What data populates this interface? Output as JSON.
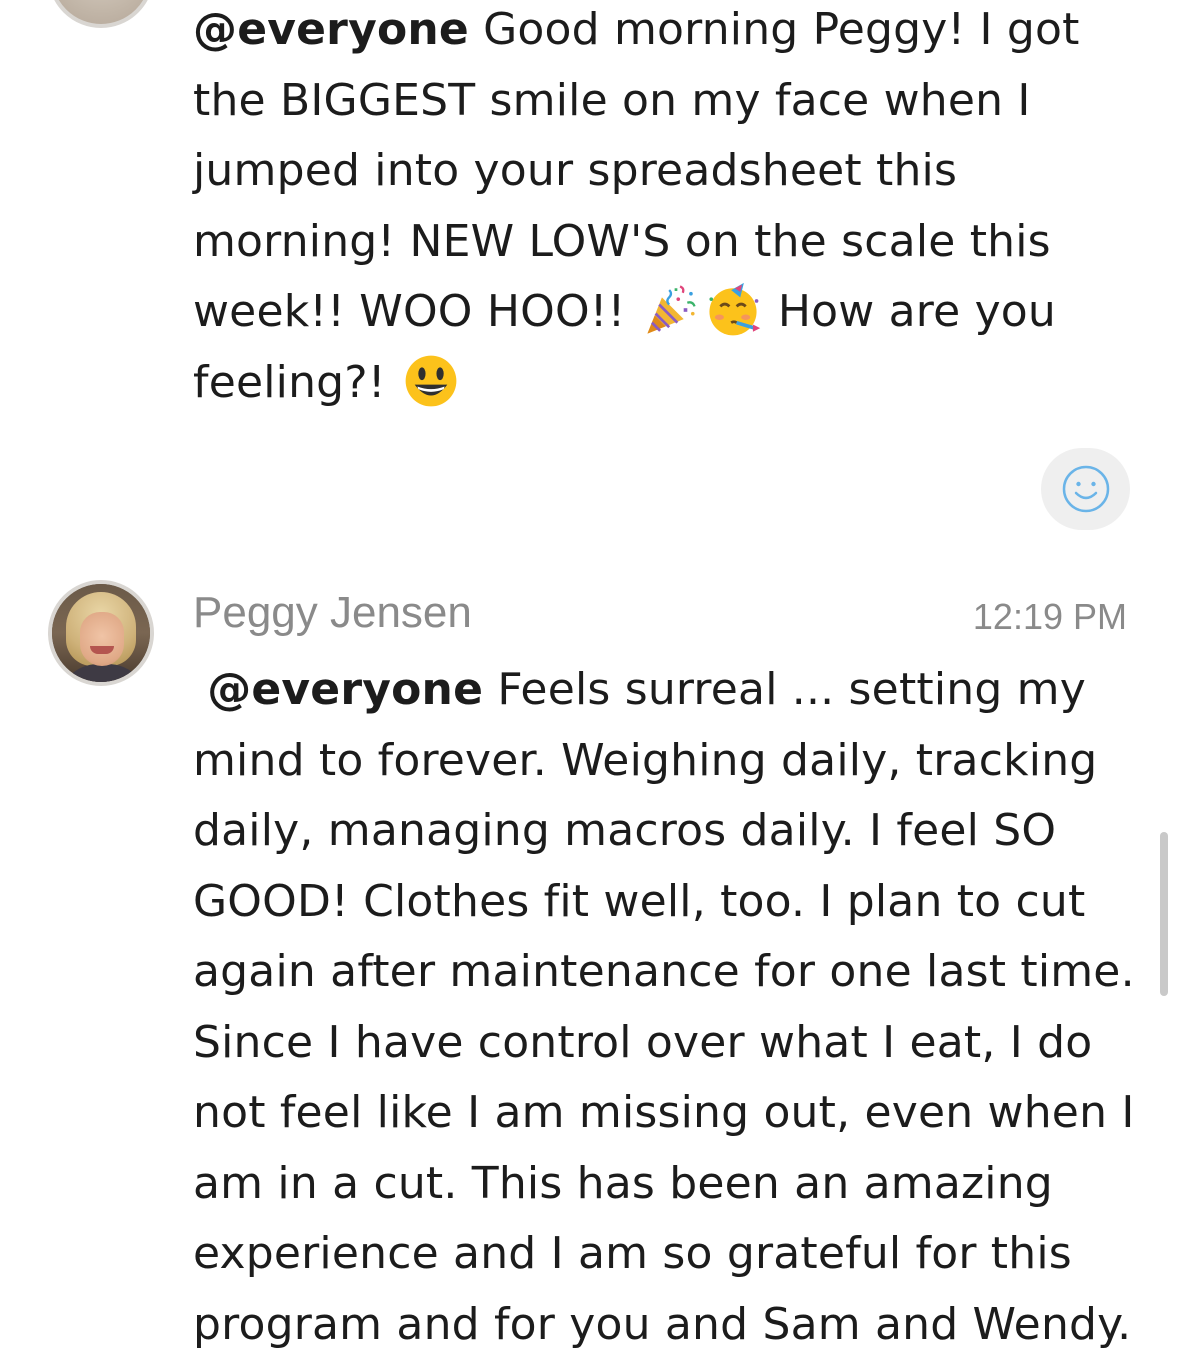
{
  "messages": [
    {
      "mention": "@everyone",
      "segments": {
        "part1": " Good morning Peggy! I got the BIGGEST smile on my face when I jumped into your spreadsheet this morning! NEW LOW'S on the scale this week!! WOO HOO!! ",
        "part2": " How are you feeling?! "
      },
      "emojis": [
        "party-popper-icon",
        "partying-face-icon",
        "smiley-face-icon"
      ]
    },
    {
      "author": "Peggy Jensen",
      "timestamp": "12:19 PM",
      "mention": "@everyone",
      "text": " Feels surreal ... setting my mind to forever. Weighing daily, tracking daily, managing macros daily. I feel SO GOOD! Clothes fit well, too. I plan to cut again after maintenance for one last time. Since I have control over what I eat, I do not feel like I am missing out, even when I am in a cut. This has been an amazing experience and I am so grateful for this program and for you and Sam and Wendy."
    }
  ],
  "reaction_button": {
    "icon": "smiley-react-icon",
    "color": "#6ab4e8"
  },
  "colors": {
    "text": "#1c1c1c",
    "muted": "#8a8a8a",
    "react_bg": "#efefef",
    "scrollbar": "#c9c9c9"
  }
}
